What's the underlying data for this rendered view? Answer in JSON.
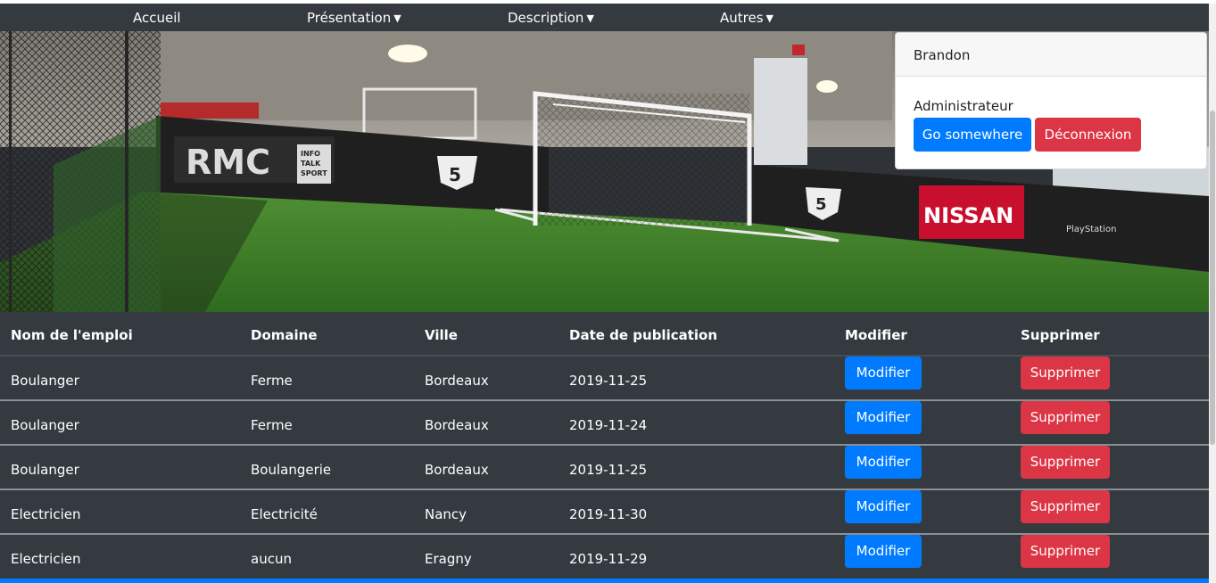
{
  "nav": {
    "items": [
      {
        "label": "Accueil",
        "caret": ""
      },
      {
        "label": "Présentation",
        "caret": "▼"
      },
      {
        "label": "Description",
        "caret": "▼"
      },
      {
        "label": "Autres",
        "caret": "▼"
      }
    ]
  },
  "hero": {
    "banner_left": "RMC",
    "banner_small": [
      "INFO",
      "TALK",
      "SPORT"
    ],
    "banner_right": "NISSAN",
    "badge": "5",
    "sponsor": "PlayStation"
  },
  "card": {
    "header": "Brandon",
    "text": "Administrateur",
    "primary_button": "Go somewhere",
    "danger_button": "Déconnexion"
  },
  "table": {
    "headers": [
      "Nom de l'emploi",
      "Domaine",
      "Ville",
      "Date de publication",
      "Modifier",
      "Supprimer"
    ],
    "rows": [
      {
        "nom": "Boulanger",
        "domaine": "Ferme",
        "ville": "Bordeaux",
        "date": "2019-11-25",
        "modifier": "Modifier",
        "supprimer": "Supprimer"
      },
      {
        "nom": "Boulanger",
        "domaine": "Ferme",
        "ville": "Bordeaux",
        "date": "2019-11-24",
        "modifier": "Modifier",
        "supprimer": "Supprimer"
      },
      {
        "nom": "Boulanger",
        "domaine": "Boulangerie",
        "ville": "Bordeaux",
        "date": "2019-11-25",
        "modifier": "Modifier",
        "supprimer": "Supprimer"
      },
      {
        "nom": "Electricien",
        "domaine": "Electricité",
        "ville": "Nancy",
        "date": "2019-11-30",
        "modifier": "Modifier",
        "supprimer": "Supprimer"
      },
      {
        "nom": "Electricien",
        "domaine": "aucun",
        "ville": "Eragny",
        "date": "2019-11-29",
        "modifier": "Modifier",
        "supprimer": "Supprimer"
      }
    ]
  },
  "colors": {
    "navbar": "#343a40",
    "primary": "#007bff",
    "danger": "#dc3545",
    "table_bg": "#343a40"
  }
}
